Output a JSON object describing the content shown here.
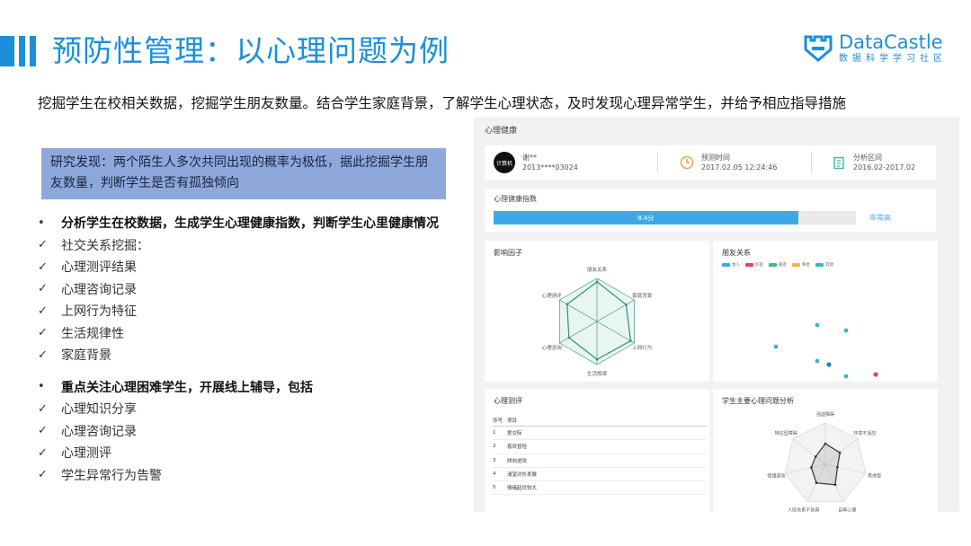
{
  "header": {
    "title": "预防性管理：以心理问题为例",
    "logo_name": "DataCastle",
    "logo_sub": "数据科学学习社区"
  },
  "intro": "挖掘学生在校相关数据，挖掘学生朋友数量。结合学生家庭背景，了解学生心理状态，及时发现心理异常学生，并给予相应指导措施",
  "finding": "研究发现：两个陌生人多次共同出现的概率为极低，据此挖掘学生朋友数量，判断学生是否有孤独倾向",
  "sections": [
    {
      "heading": "分析学生在校数据，生成学生心理健康指数，判断学生心里健康情况",
      "items": [
        "社交关系挖掘：",
        "心理测评结果",
        "心理咨询记录",
        "上网行为特征",
        "生活规律性",
        "家庭背景"
      ]
    },
    {
      "heading": "重点关注心理困难学生，开展线上辅导，包括",
      "items": [
        "心理知识分享",
        "心理咨询记录",
        "心理测评",
        "学生异常行为告警"
      ]
    }
  ],
  "marks": {
    "bullet": "•",
    "check": "✓"
  },
  "dashboard": {
    "title": "心理健康",
    "student": {
      "avatar": "计算机",
      "name": "谢**",
      "id": "2013****03024"
    },
    "predict": {
      "label": "预测时间",
      "value": "2017.02.05 12:24:46"
    },
    "range": {
      "label": "分析区间",
      "value": "2016.02-2017.02"
    },
    "health": {
      "label": "心理健康指数",
      "score_text": "8.4分",
      "score": 0.84,
      "status": "非常高"
    },
    "factors": {
      "title": "影响因子",
      "axes": [
        "朋友关系",
        "家庭背景",
        "上网行为",
        "生活规律",
        "心理咨询",
        "心理测评"
      ],
      "values": [
        0.92,
        0.78,
        0.9,
        0.88,
        0.75,
        0.8
      ]
    },
    "friends": {
      "title": "朋友关系",
      "legend": [
        "本人",
        "好友",
        "朋友",
        "熟悉",
        "其他"
      ],
      "colors": [
        "#3fa9e8",
        "#e0445c",
        "#3cc07a",
        "#f4b43c",
        "#35b8c8"
      ]
    },
    "assessment": {
      "title": "心理测评",
      "columns": [
        "序号",
        "项目"
      ],
      "rows": [
        [
          "1",
          "爱交际"
        ],
        [
          "2",
          "喜欢冒险"
        ],
        [
          "3",
          "倾向进攻"
        ],
        [
          "4",
          "渴望对外发展"
        ],
        [
          "5",
          "情绪起伏较大"
        ]
      ]
    },
    "problems": {
      "title": "学生主要心理问题分析",
      "axes": [
        "强迫障碍",
        "环境不适应",
        "焦虑型",
        "自卑心理",
        "人际关系不协调",
        "情绪波动",
        "特征型障碍"
      ],
      "values": [
        0.5,
        0.45,
        0.3,
        0.55,
        0.5,
        0.35,
        0.3
      ]
    }
  }
}
